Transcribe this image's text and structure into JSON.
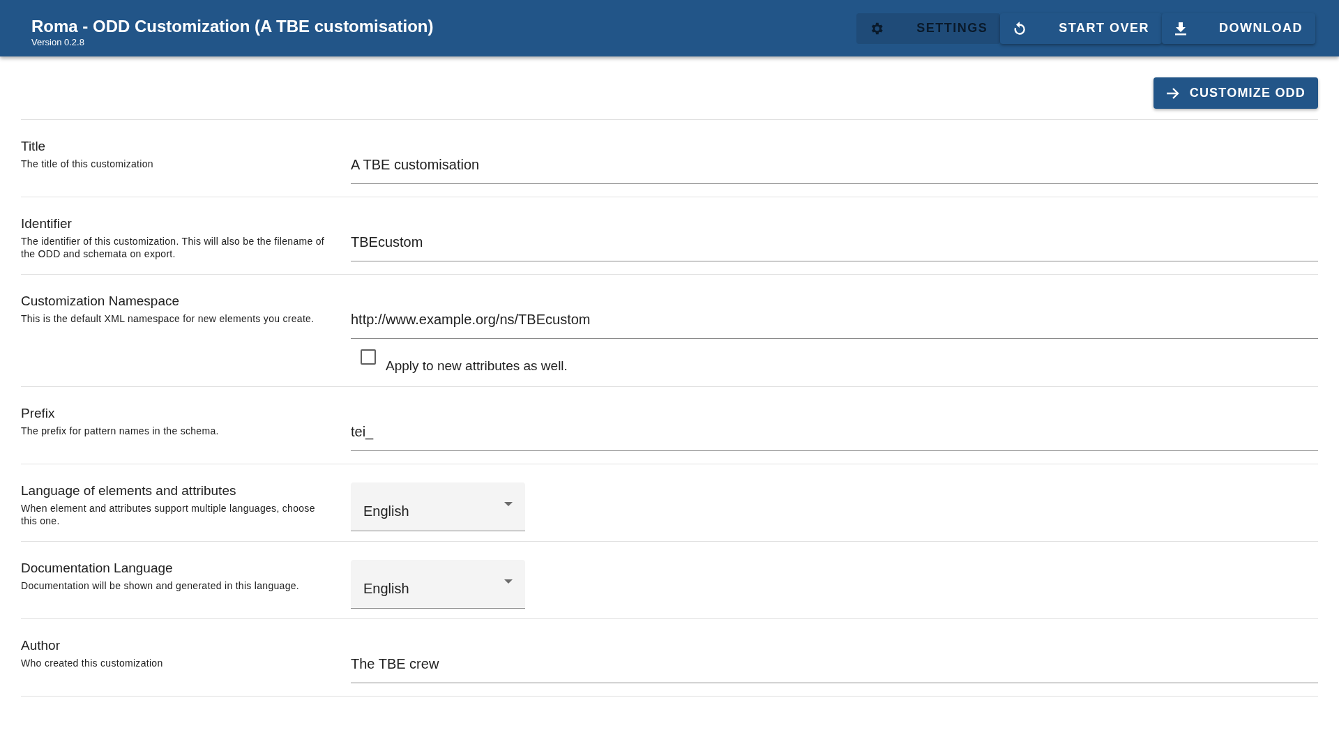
{
  "header": {
    "title": "Roma - ODD Customization (A TBE customisation)",
    "version": "Version 0.2.8",
    "buttons": [
      {
        "kind": "settings",
        "label": "SETTINGS",
        "disabled": true
      },
      {
        "kind": "start-over",
        "label": "START OVER",
        "disabled": false
      },
      {
        "kind": "download",
        "label": "DOWNLOAD",
        "disabled": false
      }
    ]
  },
  "customize_button": {
    "label": "CUSTOMIZE ODD"
  },
  "fields": [
    {
      "kind": "text",
      "label": "Title",
      "description": "The title of this customization",
      "value": "A TBE customisation"
    },
    {
      "kind": "text",
      "label": "Identifier",
      "description": "The identifier of this customization. This will also be the filename of the ODD and schemata on export.",
      "value": "TBEcustom"
    },
    {
      "kind": "text",
      "label": "Customization Namespace",
      "description": "This is the default XML namespace for new elements you create.",
      "value": "http://www.example.org/ns/TBEcustom",
      "checkbox": {
        "label": "Apply to new attributes as well.",
        "checked": false
      }
    },
    {
      "kind": "text",
      "label": "Prefix",
      "description": "The prefix for pattern names in the schema.",
      "value": "tei_"
    },
    {
      "kind": "select",
      "label": "Language of elements and attributes",
      "description": "When element and attributes support multiple languages, choose this one.",
      "value": "English"
    },
    {
      "kind": "select",
      "label": "Documentation Language",
      "description": "Documentation will be shown and generated in this language.",
      "value": "English"
    },
    {
      "kind": "text",
      "label": "Author",
      "description": "Who created this customization",
      "value": "The TBE crew"
    }
  ]
}
